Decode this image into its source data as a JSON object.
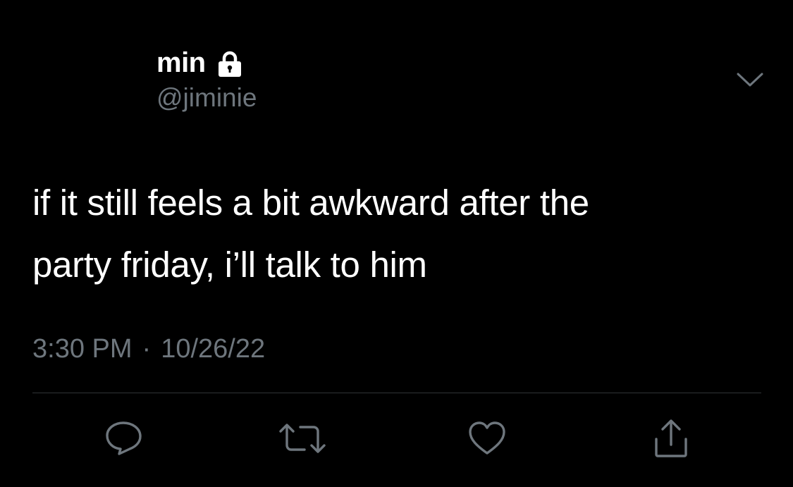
{
  "user": {
    "display_name": "min",
    "handle": "@jiminie",
    "protected_icon": "lock-icon"
  },
  "menu": {
    "caret_icon": "chevron-down-icon"
  },
  "tweet": {
    "text_line1": "if it still feels a bit awkward after the",
    "text_line2": "party friday, i’ll talk to him",
    "time": "3:30 PM",
    "separator": "·",
    "date": "10/26/22"
  },
  "actions": [
    {
      "name": "reply",
      "icon": "reply-icon"
    },
    {
      "name": "retweet",
      "icon": "retweet-icon"
    },
    {
      "name": "like",
      "icon": "heart-icon"
    },
    {
      "name": "share",
      "icon": "share-icon"
    }
  ],
  "colors": {
    "background": "#000000",
    "text_primary": "#ffffff",
    "text_secondary": "#6e767d",
    "icon": "#6e767d",
    "divider": "#2f3336"
  }
}
